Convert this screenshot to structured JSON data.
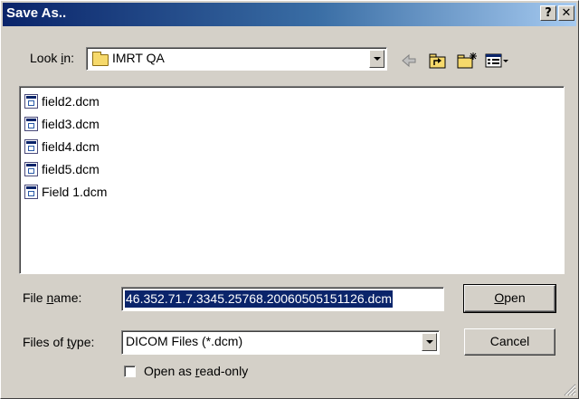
{
  "window": {
    "title": "Save As..",
    "help_button": "?",
    "close_button": "✕"
  },
  "look_in": {
    "label_pre": "Look ",
    "label_key": "i",
    "label_post": "n:",
    "value": "IMRT QA",
    "icons": [
      "back-arrow-icon",
      "up-folder-icon",
      "new-folder-icon",
      "view-menu-icon"
    ]
  },
  "files": [
    {
      "name": "field2.dcm"
    },
    {
      "name": "field3.dcm"
    },
    {
      "name": "field4.dcm"
    },
    {
      "name": "field5.dcm"
    },
    {
      "name": "Field 1.dcm"
    }
  ],
  "file_name": {
    "label_pre": "File ",
    "label_key": "n",
    "label_post": "ame:",
    "value": "46.352.71.7.3345.25768.20060505151126.dcm"
  },
  "file_type": {
    "label_pre": "Files of ",
    "label_key": "t",
    "label_post": "ype:",
    "value": "DICOM Files (*.dcm)"
  },
  "buttons": {
    "open_key": "O",
    "open_rest": "pen",
    "cancel": "Cancel"
  },
  "read_only": {
    "label_pre": "Open as ",
    "label_key": "r",
    "label_post": "ead-only",
    "checked": false
  },
  "colors": {
    "titlebar_start": "#0a246a",
    "titlebar_end": "#a6caf0",
    "face": "#d4d0c8",
    "selection": "#0a246a"
  }
}
